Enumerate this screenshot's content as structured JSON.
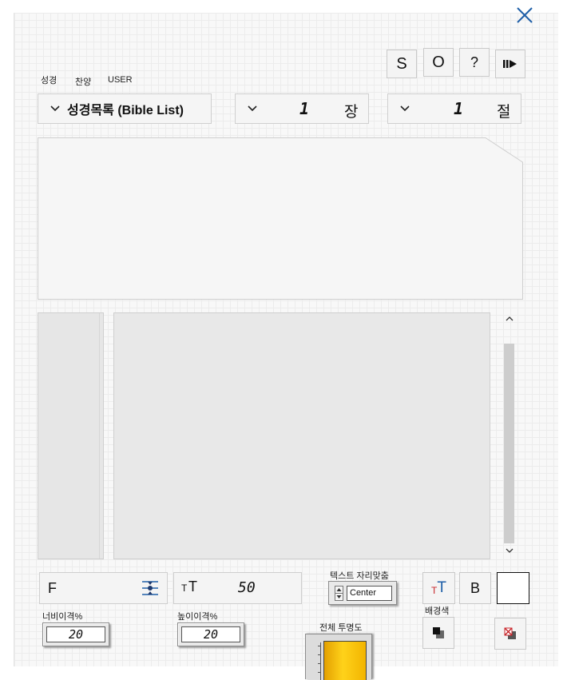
{
  "tabs": [
    "성경",
    "찬양",
    "USER"
  ],
  "toolbar": {
    "s_label": "S",
    "o_label": "O",
    "help_label": "?"
  },
  "book_select": {
    "label": "성경목록 (Bible List)"
  },
  "chapter_select": {
    "value": "1",
    "unit": "장"
  },
  "verse_select": {
    "value": "1",
    "unit": "절"
  },
  "font": {
    "label": "F"
  },
  "font_size": {
    "prefix_small": "T",
    "prefix_large": "T",
    "value": "50"
  },
  "text_align": {
    "label": "텍스트 자리맞춤",
    "value": "Center"
  },
  "format": {
    "color_small": "T",
    "color_large": "T",
    "bold_label": "B"
  },
  "background_color": {
    "label": "배경색",
    "swatch": "#ffffff"
  },
  "width_spacing": {
    "label": "너비이격%",
    "value": "20"
  },
  "height_spacing": {
    "label": "높이이격%",
    "value": "20"
  },
  "opacity": {
    "label": "전체 투명도"
  },
  "colors": {
    "accent_blue": "#1f5fa8",
    "gold": "#f2b400",
    "red": "#c8262b"
  }
}
